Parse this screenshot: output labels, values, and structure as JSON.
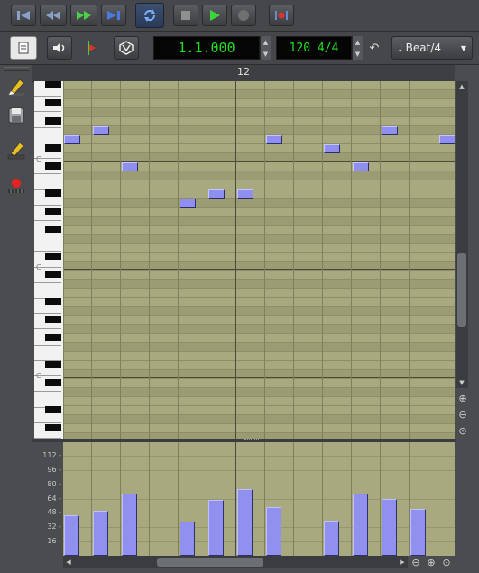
{
  "transport": {
    "buttons": [
      {
        "name": "skip-to-start-button",
        "icon": "skip-start-icon"
      },
      {
        "name": "rewind-button",
        "icon": "rewind-icon"
      },
      {
        "name": "fast-forward-button",
        "icon": "fast-forward-icon"
      },
      {
        "name": "skip-to-end-button",
        "icon": "skip-end-icon"
      },
      {
        "name": "loop-button",
        "icon": "loop-icon"
      },
      {
        "name": "stop-button",
        "icon": "stop-icon"
      },
      {
        "name": "play-button",
        "icon": "play-icon"
      },
      {
        "name": "record-button",
        "icon": "record-icon"
      },
      {
        "name": "record-mode-button",
        "icon": "record-mode-icon"
      }
    ]
  },
  "toolbar": {
    "position": "1.1.000",
    "tempo_signature": "120 4/4",
    "quantize": "Beat/4",
    "icons": [
      "document-icon",
      "speaker-icon",
      "playhead-icon",
      "snap-icon",
      "undo-icon",
      "note-icon"
    ]
  },
  "sidebar": {
    "tools": [
      "pencil-icon",
      "save-icon",
      "draw-tool-icon",
      "record-pattern-icon"
    ]
  },
  "ruler": {
    "bar_label": "12"
  },
  "piano": {
    "octave_labels": [
      "C",
      "C",
      "C"
    ]
  },
  "notes": [
    {
      "beat": 0,
      "row": 6
    },
    {
      "beat": 1,
      "row": 5
    },
    {
      "beat": 2,
      "row": 9
    },
    {
      "beat": 4,
      "row": 13
    },
    {
      "beat": 5,
      "row": 12
    },
    {
      "beat": 6,
      "row": 12
    },
    {
      "beat": 7,
      "row": 6
    },
    {
      "beat": 9,
      "row": 7
    },
    {
      "beat": 10,
      "row": 9
    },
    {
      "beat": 11,
      "row": 5
    },
    {
      "beat": 13,
      "row": 6
    }
  ],
  "velocity": {
    "axis_labels": [
      "112",
      "96",
      "80",
      "64",
      "48",
      "32",
      "16"
    ],
    "values": [
      45,
      50,
      70,
      0,
      38,
      62,
      75,
      54,
      0,
      39,
      70,
      63,
      52
    ]
  },
  "colors": {
    "grid_light": "#a9a97f",
    "grid_dark": "#9c9c74",
    "note_fill": "#8f8ff0",
    "lcd_text": "#20e020"
  }
}
